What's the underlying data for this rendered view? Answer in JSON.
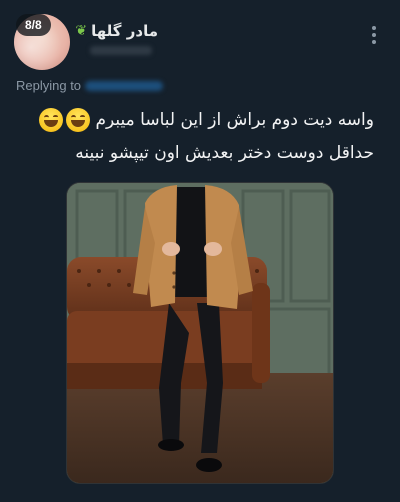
{
  "header": {
    "counter": "8/8",
    "display_name": "مادر گلها",
    "name_icon": "leaf-icon",
    "more_icon": "more-options-icon"
  },
  "reply": {
    "label": "Replying to"
  },
  "tweet": {
    "line1": "واسه دیت دوم براش از این لباسا میبرم",
    "line2": "حداقل دوست دختر بعدیش اون تیپشو نبینه",
    "emoji": "grinning-squinting-face"
  },
  "media": {
    "description_icon": "photo"
  },
  "colors": {
    "background": "#15202b",
    "text": "#e7e9ea",
    "secondary": "#8b98a5",
    "link": "#1d9bf0"
  }
}
